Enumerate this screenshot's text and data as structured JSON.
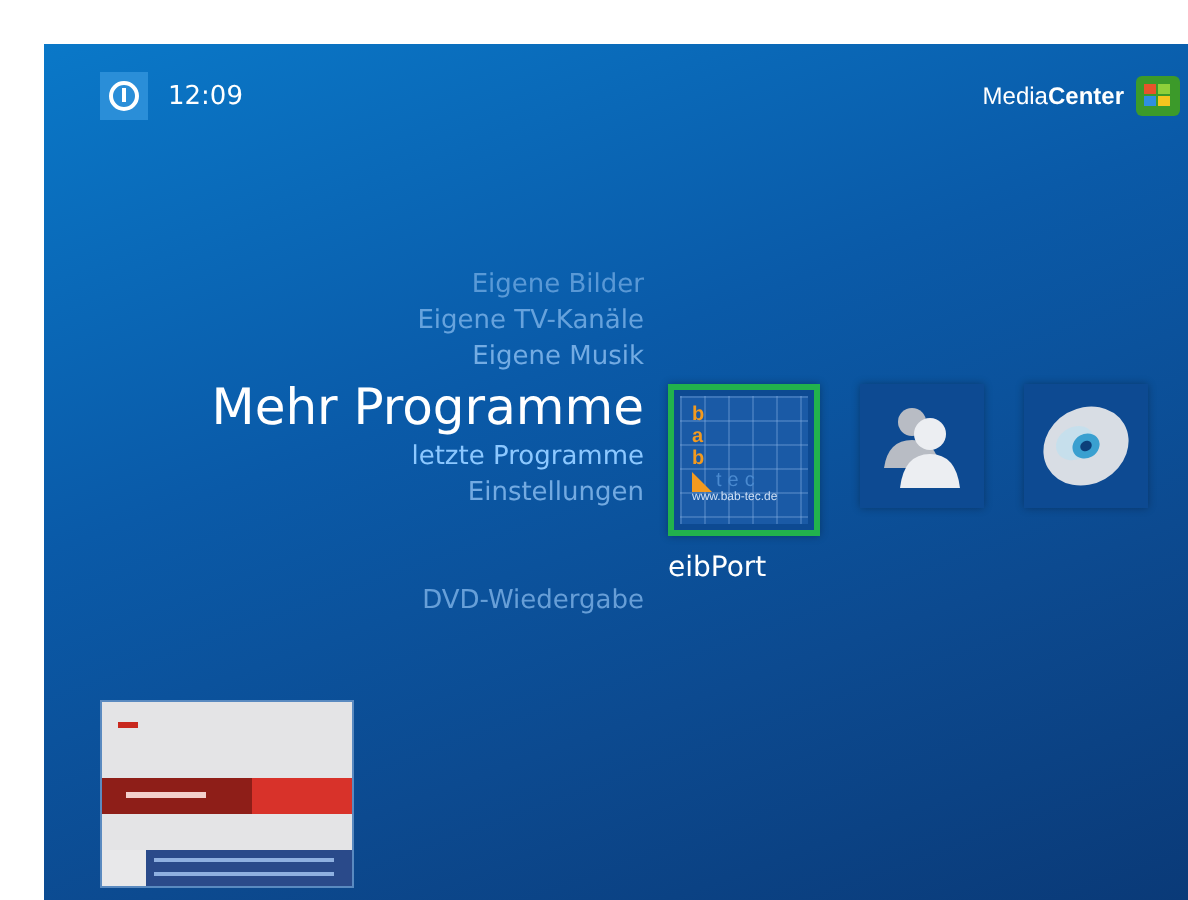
{
  "top_bar": {
    "time": "12:09",
    "brand_light": "Media",
    "brand_bold": "Center"
  },
  "menu": [
    {
      "label": "Eigene Bilder",
      "selected": false
    },
    {
      "label": "Eigene TV-Kanäle",
      "selected": false
    },
    {
      "label": "Eigene Musik",
      "selected": false
    },
    {
      "label": "Mehr Programme",
      "selected": true,
      "sublabel": "letzte Programme"
    },
    {
      "label": "Einstellungen",
      "selected": false
    },
    {
      "label": "DVD-Wiedergabe",
      "selected": false
    }
  ],
  "tiles": [
    {
      "kind": "logo",
      "selected": true,
      "label": "eibPort",
      "logo_letters": [
        "b",
        "a",
        "b"
      ],
      "logo_word": "tec",
      "logo_url": "www.bab-tec.de"
    },
    {
      "kind": "people",
      "selected": false
    },
    {
      "kind": "disc",
      "selected": false
    }
  ]
}
